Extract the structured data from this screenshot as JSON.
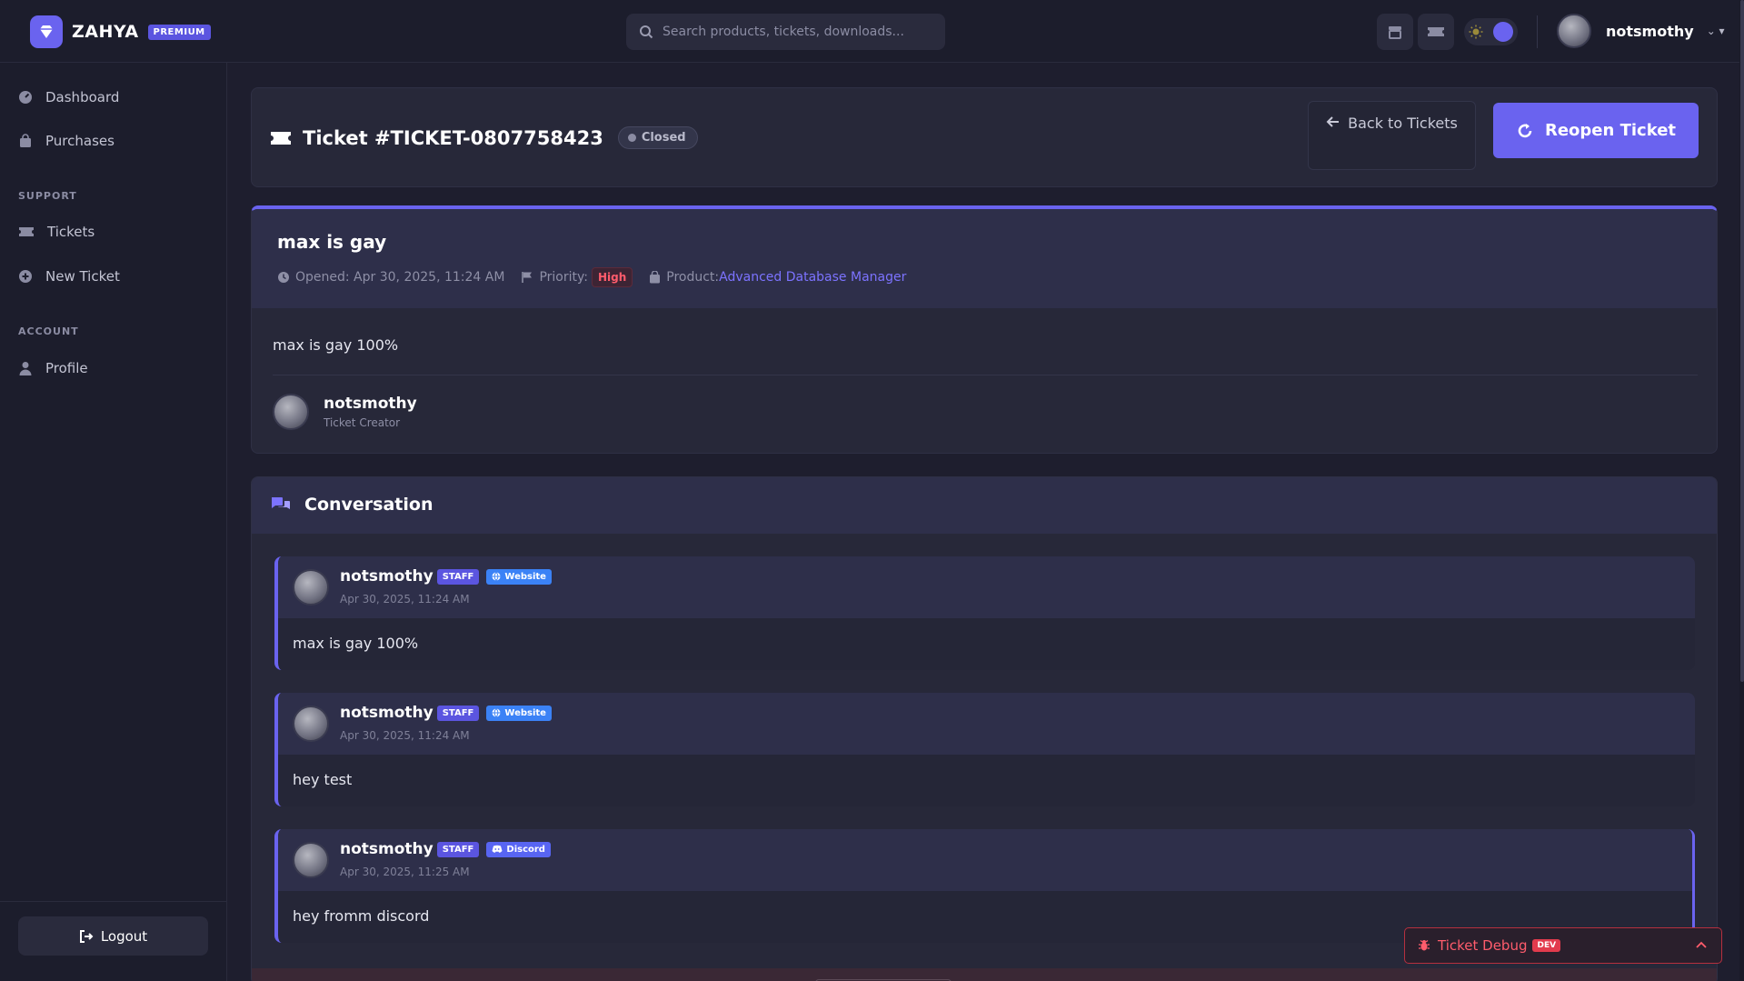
{
  "brand": {
    "name": "ZAHYA",
    "badge": "PREMIUM"
  },
  "search": {
    "placeholder": "Search products, tickets, downloads..."
  },
  "user": {
    "name": "notsmothy"
  },
  "sidebar": {
    "items": [
      {
        "label": "Dashboard",
        "icon": "dashboard-icon"
      },
      {
        "label": "Purchases",
        "icon": "bag-icon"
      }
    ],
    "support_heading": "SUPPORT",
    "support_items": [
      {
        "label": "Tickets",
        "icon": "ticket-icon"
      },
      {
        "label": "New Ticket",
        "icon": "plus-circle-icon"
      }
    ],
    "account_heading": "ACCOUNT",
    "account_items": [
      {
        "label": "Profile",
        "icon": "user-icon"
      }
    ],
    "logout_label": "Logout"
  },
  "ticket": {
    "title": "Ticket #TICKET-0807758423",
    "status": "Closed",
    "back_label": "Back to Tickets",
    "reopen_label": "Reopen Ticket",
    "subject": "max is gay",
    "opened": "Opened: Apr 30, 2025, 11:24 AM",
    "priority_label": "Priority:",
    "priority": "High",
    "product_label": "Product:",
    "product": "Advanced Database Manager",
    "body": "max is gay 100%",
    "creator_name": "notsmothy",
    "creator_role": "Ticket Creator"
  },
  "conversation": {
    "title": "Conversation",
    "messages": [
      {
        "author": "notsmothy",
        "badge": "STAFF",
        "source": "Website",
        "date": "Apr 30, 2025, 11:24 AM",
        "text": "max is gay 100%"
      },
      {
        "author": "notsmothy",
        "badge": "STAFF",
        "source": "Website",
        "date": "Apr 30, 2025, 11:24 AM",
        "text": "hey test"
      },
      {
        "author": "notsmothy",
        "badge": "STAFF",
        "source": "Discord",
        "date": "Apr 30, 2025, 11:25 AM",
        "text": "hey fromm discord"
      }
    ]
  },
  "debug": {
    "label": "Ticket Debug",
    "badge": "DEV"
  },
  "colors": {
    "accent": "#6a63ef",
    "danger": "#ff5c6c",
    "website": "#3b82f6",
    "discord": "#5865f2"
  }
}
